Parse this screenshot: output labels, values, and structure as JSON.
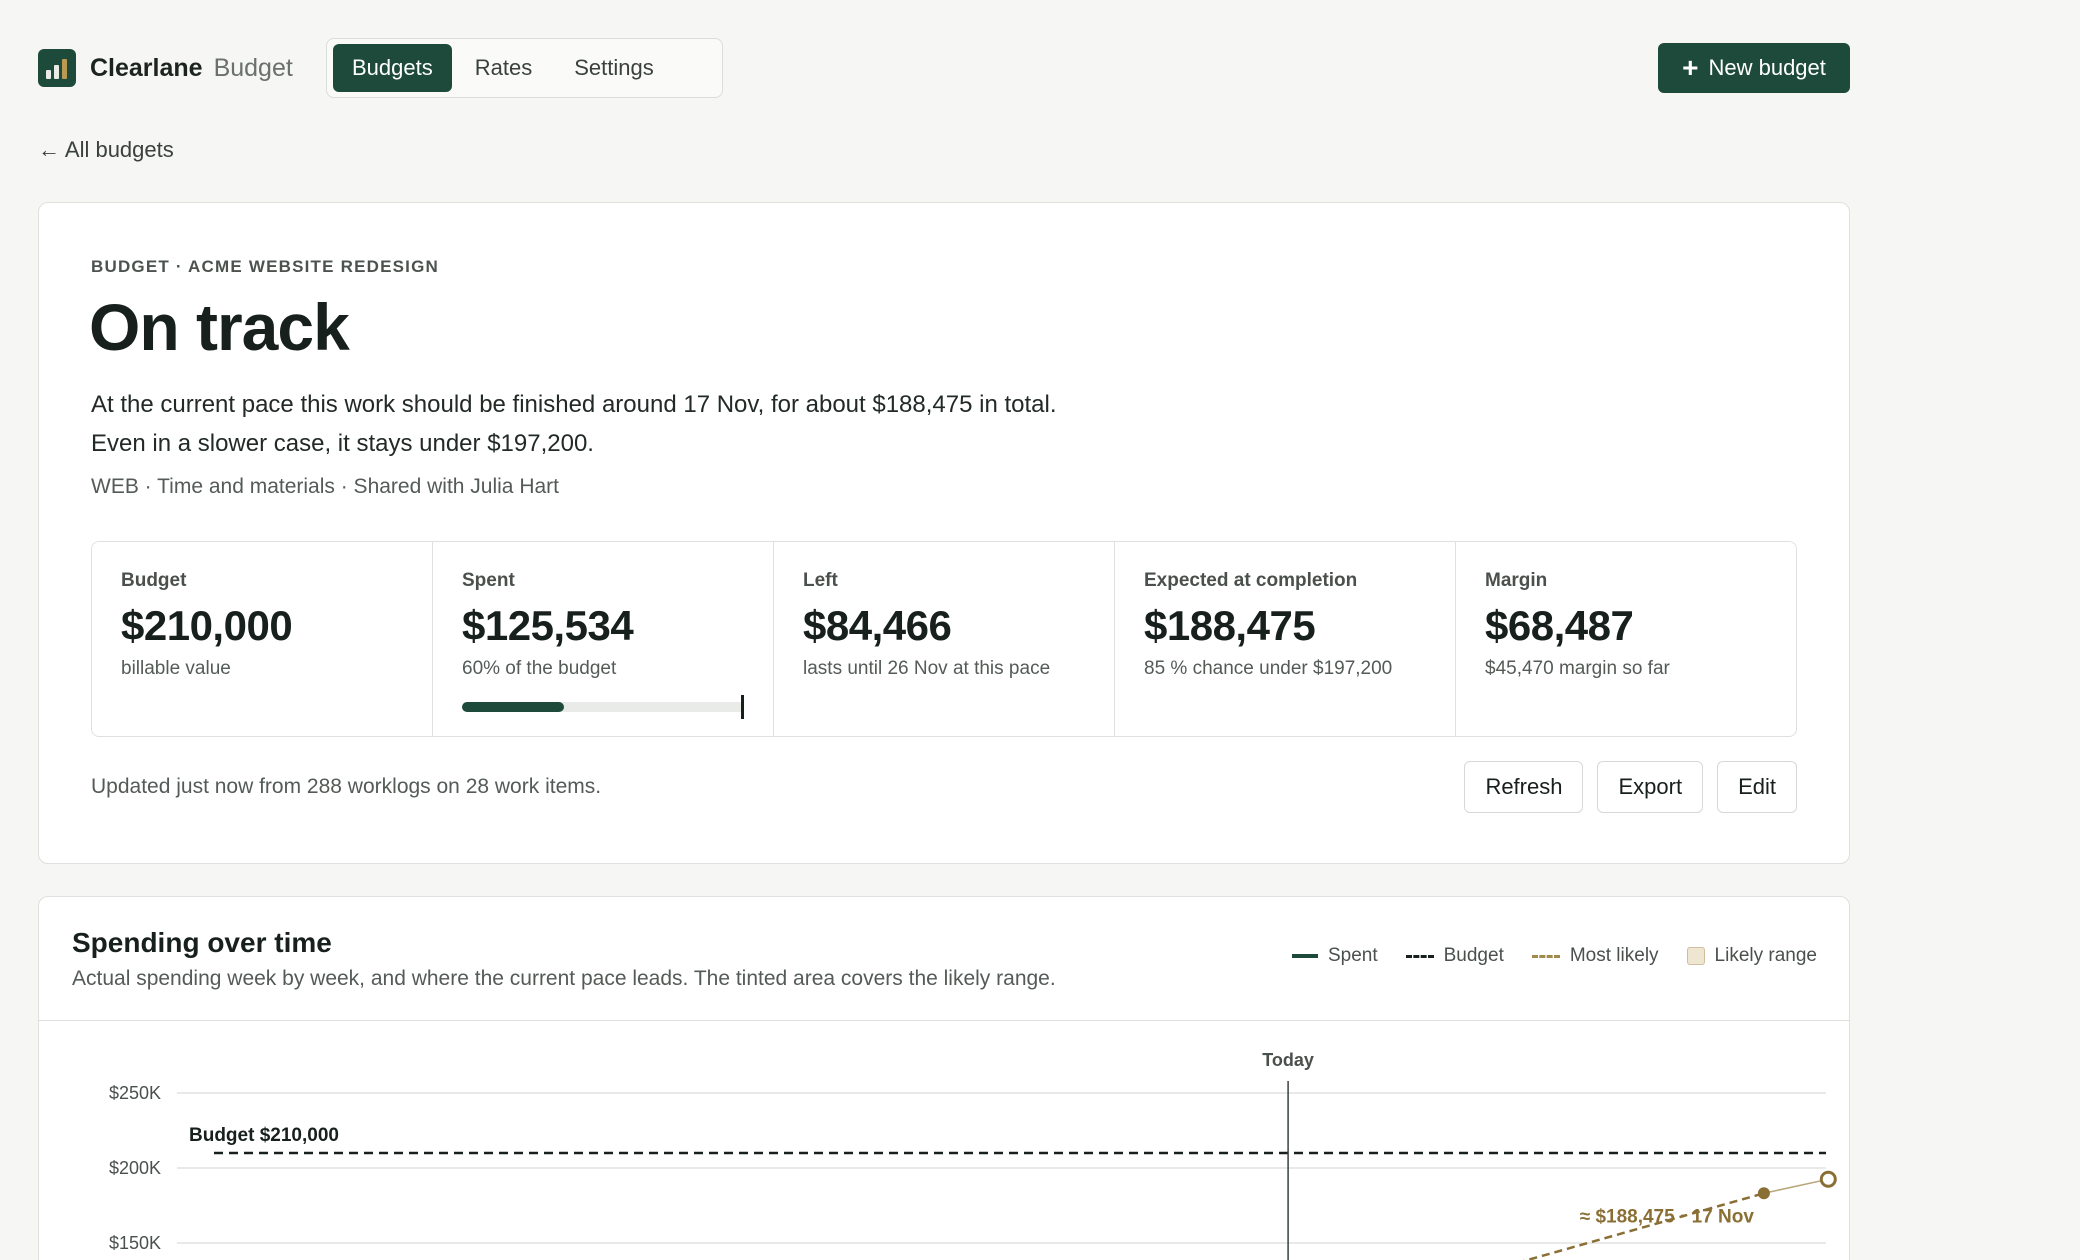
{
  "app": {
    "name": "Clearlane",
    "section": "Budget",
    "nav_tabs": [
      {
        "label": "Budgets",
        "active": true
      },
      {
        "label": "Rates",
        "active": false
      },
      {
        "label": "Settings",
        "active": false
      }
    ],
    "new_budget_label": "New budget",
    "back_link": "← All budgets"
  },
  "summary": {
    "eyebrow": "BUDGET · ACME WEBSITE REDESIGN",
    "status": "On track",
    "line1": "At the current pace this work should be finished around 17 Nov, for about $188,475 in total.",
    "line2": "Even in a slower case, it stays under $197,200.",
    "meta": "WEB · Time and materials · Shared with Julia Hart",
    "stats": [
      {
        "label": "Budget",
        "value": "$210,000",
        "sub": "billable value"
      },
      {
        "label": "Spent",
        "value": "$125,534",
        "sub": "60% of the budget",
        "progress": 0.6
      },
      {
        "label": "Left",
        "value": "$84,466",
        "sub": "lasts until 26 Nov at this pace"
      },
      {
        "label": "Expected at completion",
        "value": "$188,475",
        "sub": "85 % chance under $197,200"
      },
      {
        "label": "Margin",
        "value": "$68,487",
        "sub": "$45,470 margin so far"
      }
    ],
    "updated": "Updated just now from 288 worklogs on 28 work items.",
    "actions": [
      "Refresh",
      "Export",
      "Edit"
    ]
  },
  "chart": {
    "title": "Spending over time",
    "subtitle": "Actual spending week by week, and where the current pace leads. The tinted area covers the likely range.",
    "legend": [
      "Spent",
      "Budget",
      "Most likely",
      "Likely range"
    ],
    "colors": {
      "spent": "#1e4a3c",
      "budget": "#17201c",
      "forecast": "#8a6f35",
      "range": "#efe6d2"
    }
  },
  "chart_data": {
    "type": "line",
    "y_ticks": [
      "$250K",
      "$200K",
      "$150K"
    ],
    "y_tick_values": [
      250000,
      200000,
      150000
    ],
    "ylim": [
      120000,
      250000
    ],
    "budget_line": {
      "value": 210000,
      "label": "Budget $210,000"
    },
    "today_label": "Today",
    "forecast_label": "≈ $188,475 · 17 Nov",
    "forecast_points": [
      {
        "t": 0.62,
        "value": 120000
      },
      {
        "t": 0.89,
        "value": 188475
      },
      {
        "t": 0.93,
        "value": 197200
      }
    ],
    "today_t": 0.61
  }
}
